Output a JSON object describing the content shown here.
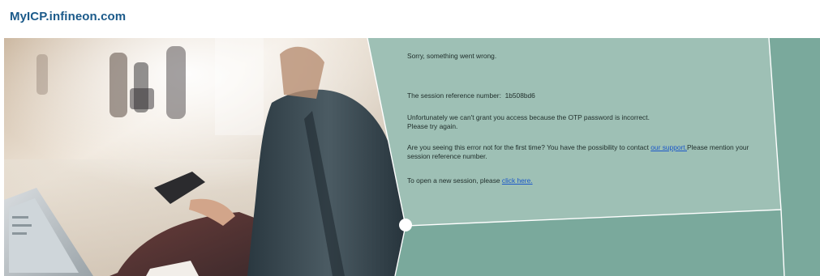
{
  "header": {
    "site_title": "MyICP.infineon.com"
  },
  "message": {
    "error_text": "Sorry, something went wrong.",
    "ref_label": "The session reference number:",
    "ref_value": "1b508bd6",
    "otp_line1": "Unfortunately we can't grant you access because the OTP password is incorrect.",
    "otp_line2": "Please try again.",
    "contact_before": "Are you seeing this error not for the first time? You have the possibility to contact ",
    "contact_link": "our support.",
    "contact_after": "Please mention your session reference number.",
    "new_session_before": "To open a new session, please ",
    "new_session_link": "click here."
  },
  "colors": {
    "brand_title": "#1b5a8a",
    "panel_light": "#9ec0b5",
    "panel_dark": "#7aa99c",
    "link": "#1a57c9"
  },
  "icons": {
    "panel_node": "white-circle-node-icon"
  }
}
